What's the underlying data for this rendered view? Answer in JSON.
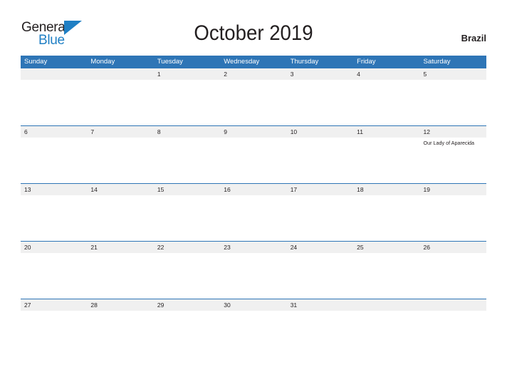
{
  "logo": {
    "word_one": "General",
    "word_two": "Blue",
    "triangle_color": "#1f7fc4",
    "triangle_icon": "triangle-icon"
  },
  "header": {
    "title": "October 2019",
    "country": "Brazil"
  },
  "colors": {
    "header_blue": "#2e75b6",
    "row_band_gray": "#f0f0f0",
    "text_dark": "#231f20",
    "logo_blue": "#1f7fc4"
  },
  "calendar": {
    "month": "October",
    "year": "2019",
    "weekday_headers": [
      "Sunday",
      "Monday",
      "Tuesday",
      "Wednesday",
      "Thursday",
      "Friday",
      "Saturday"
    ],
    "weeks": [
      [
        {
          "date": "",
          "events": []
        },
        {
          "date": "",
          "events": []
        },
        {
          "date": "1",
          "events": []
        },
        {
          "date": "2",
          "events": []
        },
        {
          "date": "3",
          "events": []
        },
        {
          "date": "4",
          "events": []
        },
        {
          "date": "5",
          "events": []
        }
      ],
      [
        {
          "date": "6",
          "events": []
        },
        {
          "date": "7",
          "events": []
        },
        {
          "date": "8",
          "events": []
        },
        {
          "date": "9",
          "events": []
        },
        {
          "date": "10",
          "events": []
        },
        {
          "date": "11",
          "events": []
        },
        {
          "date": "12",
          "events": [
            "Our Lady of Aparecida"
          ]
        }
      ],
      [
        {
          "date": "13",
          "events": []
        },
        {
          "date": "14",
          "events": []
        },
        {
          "date": "15",
          "events": []
        },
        {
          "date": "16",
          "events": []
        },
        {
          "date": "17",
          "events": []
        },
        {
          "date": "18",
          "events": []
        },
        {
          "date": "19",
          "events": []
        }
      ],
      [
        {
          "date": "20",
          "events": []
        },
        {
          "date": "21",
          "events": []
        },
        {
          "date": "22",
          "events": []
        },
        {
          "date": "23",
          "events": []
        },
        {
          "date": "24",
          "events": []
        },
        {
          "date": "25",
          "events": []
        },
        {
          "date": "26",
          "events": []
        }
      ],
      [
        {
          "date": "27",
          "events": []
        },
        {
          "date": "28",
          "events": []
        },
        {
          "date": "29",
          "events": []
        },
        {
          "date": "30",
          "events": []
        },
        {
          "date": "31",
          "events": []
        },
        {
          "date": "",
          "events": []
        },
        {
          "date": "",
          "events": []
        }
      ]
    ]
  }
}
